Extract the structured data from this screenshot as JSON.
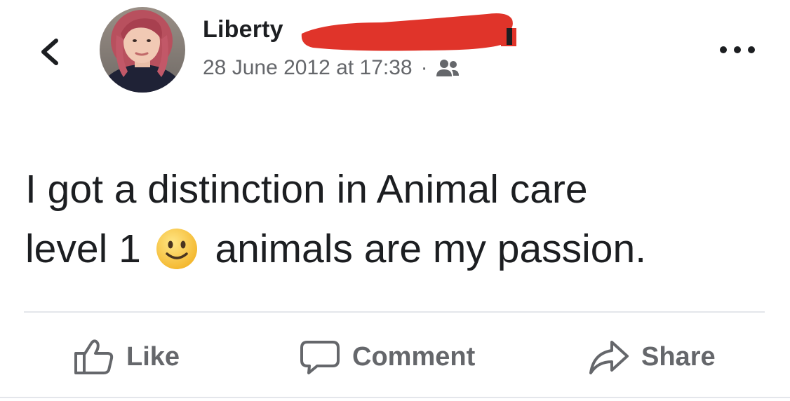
{
  "header": {
    "author_name": "Liberty",
    "timestamp": "28 June 2012 at 17:38",
    "separator": "·",
    "audience_icon": "friends-icon",
    "back_icon": "chevron-left-icon",
    "more_icon": "more-horizontal-icon"
  },
  "post": {
    "line1": "I got a distinction in Animal care",
    "line2_before": "level 1",
    "emoji": "slightly-smiling-face",
    "line2_after": "animals are my passion."
  },
  "actions": {
    "like_label": "Like",
    "comment_label": "Comment",
    "share_label": "Share"
  },
  "colors": {
    "text_primary": "#1c1e21",
    "text_secondary": "#65676b",
    "divider": "#e4e6eb",
    "redaction": "#e0342a"
  }
}
